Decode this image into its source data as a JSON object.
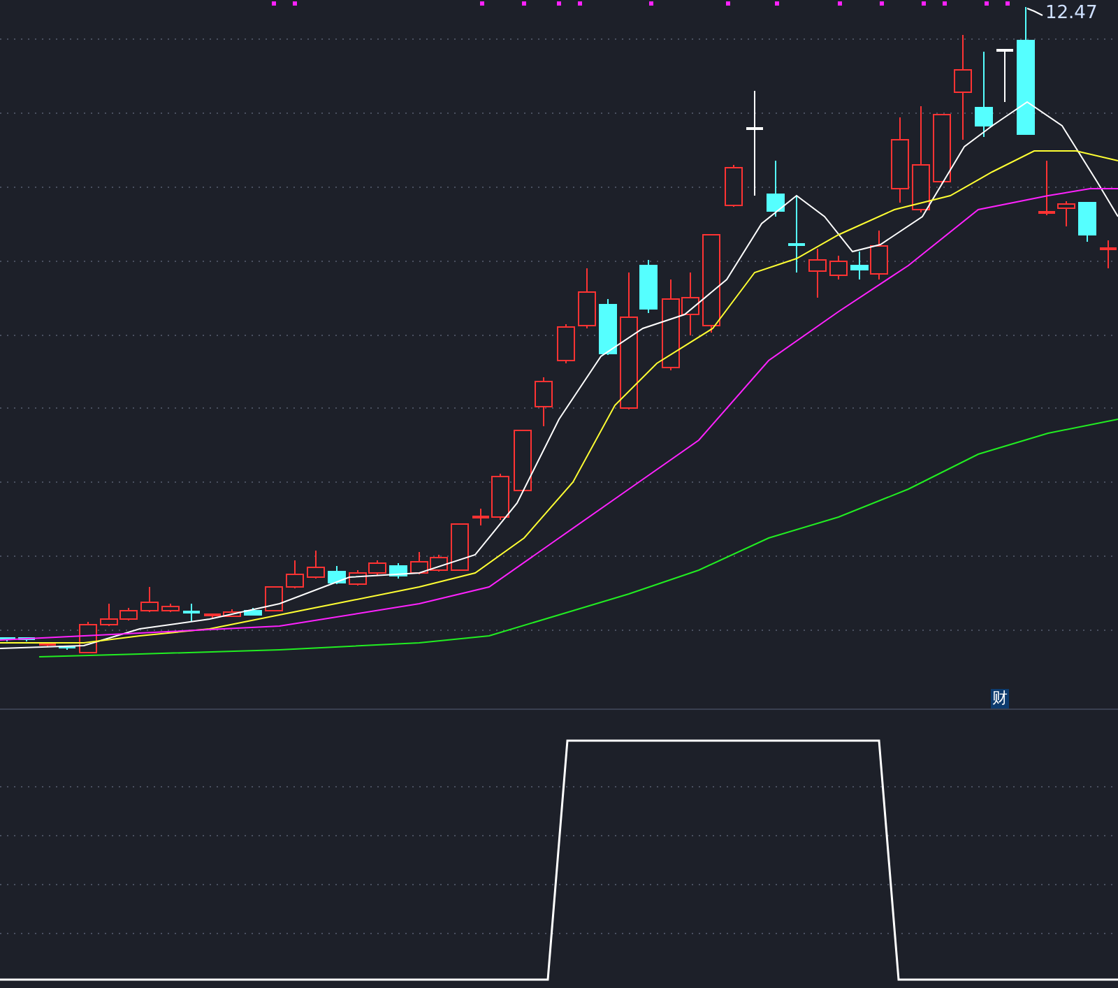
{
  "price_chart": {
    "high_label": "12.47"
  },
  "indicator_panel": {
    "badge": "财"
  }
}
